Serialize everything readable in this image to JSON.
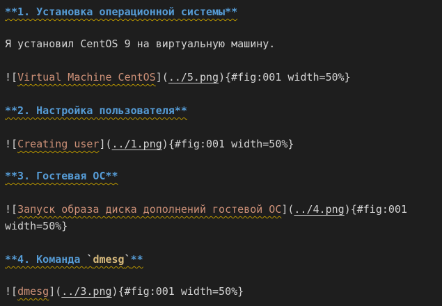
{
  "sections": [
    {
      "heading": "**1. Установка операционной системы**",
      "paragraph": "Я установил CentOS 9 на виртуальную машину.",
      "image": {
        "prefix": "![",
        "alt": "Virtual Machine CentOS",
        "mid": "](",
        "url": "../5.png",
        "close": ")",
        "attrs": "{#fig:001 width=50%}"
      }
    },
    {
      "heading": "**2. Настройка пользователя**",
      "image": {
        "prefix": "![",
        "alt": "Creating user",
        "mid": "](",
        "url": "../1.png",
        "close": ")",
        "attrs": "{#fig:001 width=50%}"
      }
    },
    {
      "heading": "**3. Гостевая ОС**",
      "image": {
        "prefix": "![",
        "alt": "Запуск образа диска дополнений гостевой ОС",
        "mid": "](",
        "url": "../4.png",
        "close": ")",
        "attrs": "{#fig:001",
        "attrs_wrap": "width=50%}"
      }
    },
    {
      "heading_pre": "**4. Команда ",
      "heading_bt_open": "`",
      "heading_code": "dmesg",
      "heading_bt_close": "`",
      "heading_post": "**",
      "image": {
        "prefix": "![",
        "alt": "dmesg",
        "mid": "](",
        "url": "../3.png",
        "close": ")",
        "attrs": "{#fig:001 width=50%}"
      }
    }
  ]
}
